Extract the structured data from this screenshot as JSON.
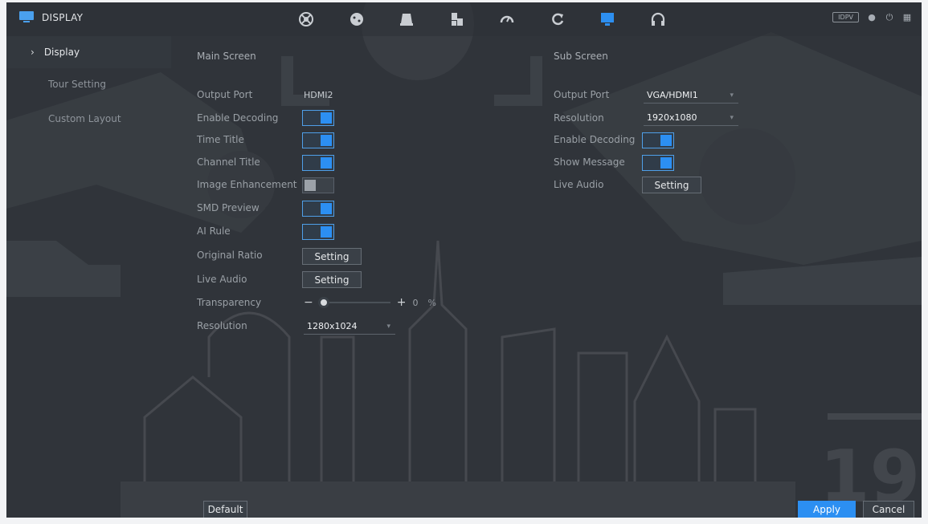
{
  "header": {
    "title": "DISPLAY",
    "title_icon": "monitor-icon",
    "nav_icons": [
      "camera-icon",
      "smart-icon",
      "storage-icon",
      "network-icon",
      "gauge-icon",
      "refresh-icon",
      "display-icon",
      "headset-icon"
    ],
    "active_nav": "display-icon",
    "badge": "IDPV",
    "tools": [
      "user-icon",
      "shutdown-icon",
      "grid-icon"
    ]
  },
  "sidebar": {
    "items": [
      {
        "label": "Display",
        "active": true
      },
      {
        "label": "Tour Setting",
        "active": false
      },
      {
        "label": "Custom Layout",
        "active": false
      }
    ]
  },
  "main_screen": {
    "heading": "Main Screen",
    "output_port_label": "Output Port",
    "output_port_value": "HDMI2",
    "enable_decoding_label": "Enable Decoding",
    "enable_decoding": true,
    "time_title_label": "Time Title",
    "time_title": true,
    "channel_title_label": "Channel Title",
    "channel_title": true,
    "image_enhancement_label": "Image Enhancement",
    "image_enhancement": false,
    "smd_preview_label": "SMD Preview",
    "smd_preview": true,
    "ai_rule_label": "AI Rule",
    "ai_rule": true,
    "original_ratio_label": "Original Ratio",
    "original_ratio_button": "Setting",
    "live_audio_label": "Live Audio",
    "live_audio_button": "Setting",
    "transparency_label": "Transparency",
    "transparency_minus": "−",
    "transparency_plus": "+",
    "transparency_value": "0",
    "transparency_unit": "%",
    "resolution_label": "Resolution",
    "resolution_value": "1280x1024"
  },
  "sub_screen": {
    "heading": "Sub Screen",
    "output_port_label": "Output Port",
    "output_port_value": "VGA/HDMI1",
    "resolution_label": "Resolution",
    "resolution_value": "1920x1080",
    "enable_decoding_label": "Enable Decoding",
    "enable_decoding": true,
    "show_message_label": "Show Message",
    "show_message": true,
    "live_audio_label": "Live Audio",
    "live_audio_button": "Setting"
  },
  "footer": {
    "default_label": "Default",
    "apply_label": "Apply",
    "cancel_label": "Cancel"
  },
  "colors": {
    "accent": "#2c8ff2",
    "background": "#2f3338",
    "frame": "#f2f3f5"
  }
}
